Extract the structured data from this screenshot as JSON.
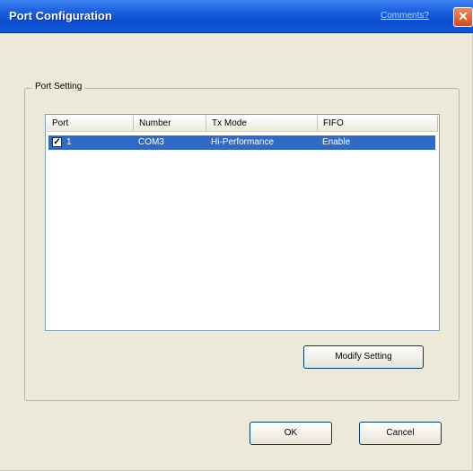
{
  "window": {
    "title": "Port Configuration",
    "comments_link": "Comments?",
    "close_glyph": "✕"
  },
  "port_setting": {
    "group_label": "Port Setting",
    "columns": [
      "Port",
      "Number",
      "Tx Mode",
      "FIFO"
    ],
    "rows": [
      {
        "checked": true,
        "port": "1",
        "number": "COM3",
        "tx_mode": "Hi-Performance",
        "fifo": "Enable"
      }
    ]
  },
  "buttons": {
    "modify_setting": "Modify Setting",
    "ok": "OK",
    "cancel": "Cancel"
  },
  "colors": {
    "titlebar": "#1157d8",
    "selection": "#316ac5",
    "window_bg": "#ece9d8"
  }
}
